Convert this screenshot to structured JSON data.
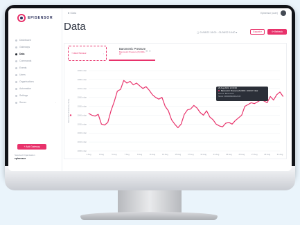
{
  "app": {
    "brand_name": "EPISENSOR",
    "breadcrumb": "■  /  Data",
    "user_name": "Episensor (user)"
  },
  "sidebar": {
    "items": [
      {
        "label": "Dashboard",
        "active": false,
        "expandable": false
      },
      {
        "label": "Gateways",
        "active": false,
        "expandable": false
      },
      {
        "label": "Data",
        "active": true,
        "expandable": false
      },
      {
        "label": "Commands",
        "active": false,
        "expandable": false
      },
      {
        "label": "Events",
        "active": false,
        "expandable": false
      },
      {
        "label": "Users",
        "active": false,
        "expandable": false
      },
      {
        "label": "Organisations",
        "active": false,
        "expandable": false
      },
      {
        "label": "Automation",
        "active": false,
        "expandable": false
      },
      {
        "label": "Settings",
        "active": false,
        "expandable": false
      },
      {
        "label": "Server",
        "active": false,
        "expandable": true
      }
    ],
    "add_gateway_label": "+ Add Gateway",
    "org_label": "Selected Organisation",
    "org_value": "episensor"
  },
  "page": {
    "title": "Data",
    "date_range": "01/08/22 18:00 - 01/08/22 18:00",
    "export_label": "Export",
    "refresh_label": "Refresh"
  },
  "sensor_selector": {
    "add_label": "+ Add Sensor",
    "active_sensor_name": "Barometric Pressure",
    "active_sensor_sub": "Barometric Pressure (5) 0001-07"
  },
  "tooltip": {
    "date": "29 Aug 2022, 12:00:00",
    "series_value": "Barometric Pressure (5) 0001: 1010.07 mbar",
    "line2": "Device: Barometric",
    "line3": "Serial: 0000009400012345"
  },
  "colors": {
    "accent": "#e8326b",
    "text_dark": "#2d3340",
    "text_muted": "#8e96a3",
    "grid": "#eef0f3"
  },
  "chart_data": {
    "type": "line",
    "ylabel": "Barometric Pressure (mbar)",
    "yticks": [
      "1000 mbar",
      "1010 mbar",
      "1020 mbar",
      "1030 mbar",
      "1040 mbar",
      "1050 mbar",
      "1060 mbar",
      "1070 mbar",
      "1080 mbar",
      "1090 mbar"
    ],
    "ylim": [
      1000,
      1090
    ],
    "xticks": [
      "1 Aug",
      "3 Aug",
      "5 Aug",
      "7 Aug",
      "9 Aug",
      "11 Aug",
      "13 Aug",
      "15 Aug",
      "17 Aug",
      "19 Aug",
      "21 Aug",
      "23 Aug",
      "25 Aug",
      "27 Aug",
      "29 Aug",
      "31 Aug"
    ],
    "grid": true,
    "series": [
      {
        "color": "#e8326b",
        "x": [
          0,
          0.5,
          1,
          1.5,
          2,
          2.5,
          3,
          3.5,
          4,
          4.5,
          5,
          5.5,
          6,
          6.5,
          7,
          7.5,
          8,
          8.5,
          9,
          9.5,
          10,
          10.5,
          11,
          11.5,
          12,
          12.5,
          13,
          13.5,
          14,
          14.5,
          15,
          15.5,
          16,
          16.5,
          17,
          17.5,
          18,
          18.5,
          19,
          19.5,
          20,
          20.5,
          21,
          21.5,
          22,
          22.5,
          23,
          23.5,
          24,
          24.5,
          25,
          25.5,
          26,
          26.5,
          27,
          27.5,
          28,
          28.5,
          29,
          29.5,
          30,
          30.5
        ],
        "values": [
          1042,
          1040,
          1039,
          1041,
          1030,
          1029,
          1032,
          1045,
          1055,
          1067,
          1069,
          1079,
          1076,
          1078,
          1074,
          1076,
          1073,
          1070,
          1072,
          1068,
          1063,
          1060,
          1058,
          1060,
          1050,
          1045,
          1035,
          1030,
          1026,
          1030,
          1041,
          1046,
          1047,
          1051,
          1048,
          1043,
          1040,
          1045,
          1038,
          1035,
          1030,
          1028,
          1027,
          1031,
          1032,
          1030,
          1034,
          1037,
          1040,
          1050,
          1052,
          1054,
          1053,
          1055,
          1057,
          1056,
          1054,
          1061,
          1057,
          1063,
          1066,
          1061
        ]
      }
    ]
  }
}
